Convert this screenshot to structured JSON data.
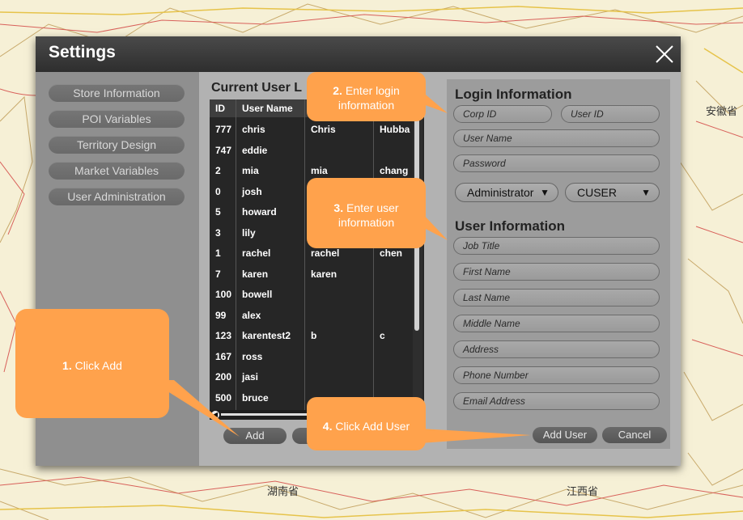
{
  "map": {
    "labels": [
      "安徽省",
      "湖南省",
      "江西省"
    ]
  },
  "dialog": {
    "title": "Settings",
    "nav": [
      "Store Information",
      "POI Variables",
      "Territory Design",
      "Market Variables",
      "User Administration"
    ],
    "user_list": {
      "title": "Current User L",
      "headers": [
        "ID",
        "User Name",
        "",
        ""
      ],
      "rows": [
        [
          "777",
          "chris",
          "Chris",
          "Hubba"
        ],
        [
          "747",
          "eddie",
          "",
          ""
        ],
        [
          "2",
          "mia",
          "mia",
          "chang"
        ],
        [
          "0",
          "josh",
          "",
          ""
        ],
        [
          "5",
          "howard",
          "",
          ""
        ],
        [
          "3",
          "lily",
          "",
          ""
        ],
        [
          "1",
          "rachel",
          "rachel",
          "chen"
        ],
        [
          "7",
          "karen",
          "karen",
          ""
        ],
        [
          "100",
          "bowell",
          "",
          ""
        ],
        [
          "99",
          "alex",
          "",
          ""
        ],
        [
          "123",
          "karentest2",
          "b",
          "c"
        ],
        [
          "167",
          "ross",
          "",
          ""
        ],
        [
          "200",
          "jasi",
          "",
          ""
        ],
        [
          "500",
          "bruce",
          "",
          ""
        ]
      ],
      "add_label": "Add"
    },
    "login": {
      "heading": "Login Information",
      "corp_id": "Corp ID",
      "user_id": "User ID",
      "user_name": "User Name",
      "password": "Password",
      "role": "Administrator",
      "usertype": "CUSER",
      "arrow": "▼"
    },
    "userinfo": {
      "heading": "User Information",
      "fields": [
        "Job Title",
        "First Name",
        "Last Name",
        "Middle Name",
        "Address",
        "Phone Number",
        "Email Address"
      ]
    },
    "add_user_label": "Add User",
    "cancel_label": "Cancel"
  },
  "callouts": [
    {
      "num": "1.",
      "text": "Click Add"
    },
    {
      "num": "2.",
      "text": "Enter login",
      "text2": "information"
    },
    {
      "num": "3.",
      "text": "Enter user",
      "text2": "information"
    },
    {
      "num": "4.",
      "text": "Click Add User"
    }
  ],
  "colors": {
    "callout": "#ffa24c",
    "titlebar": "#3a3a3a",
    "grid": "#262626"
  }
}
